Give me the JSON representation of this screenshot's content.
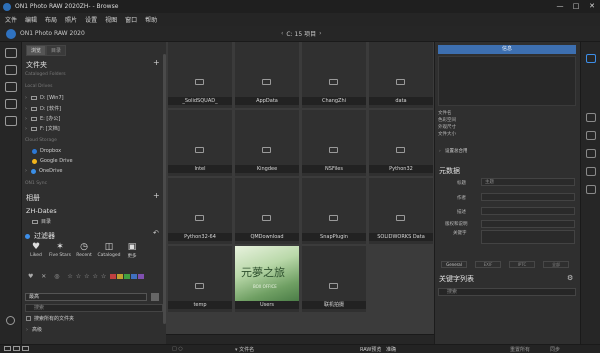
{
  "window": {
    "title": "ON1 Photo RAW 2020ZH- - Browse",
    "controls": [
      "—",
      "□",
      "✕"
    ]
  },
  "menu": [
    "文件",
    "编辑",
    "布局",
    "照片",
    "设置",
    "视图",
    "窗口",
    "帮助"
  ],
  "header": {
    "app_name": "ON1 Photo RAW 2020",
    "path": "C: 15 项目",
    "back": "‹",
    "forward": "›"
  },
  "left_panel": {
    "tabs": [
      "浏览",
      "目录"
    ],
    "folders_title": "文件夹",
    "cataloged_label": "Cataloged Folders",
    "local_label": "Local Drives",
    "drives": [
      "D: [Win7]",
      "D: [软件]",
      "E: [办公]",
      "F: [文档]"
    ],
    "cloud_label": "Cloud Storage",
    "cloud": [
      "Dropbox",
      "Google Drive",
      "OneDrive"
    ],
    "sync_label": "ON1 Sync",
    "albums_title": "相册",
    "albums_sub": "ZH-Dates",
    "album_item": "目录",
    "filters_title": "过滤器",
    "filters": [
      {
        "icon": "heart",
        "label": "Liked"
      },
      {
        "icon": "stars",
        "label": "Five Stars"
      },
      {
        "icon": "clock",
        "label": "Recent"
      },
      {
        "icon": "catalog",
        "label": "Cataloged"
      },
      {
        "icon": "more",
        "label": "更多"
      }
    ],
    "sort_value": "最高",
    "search_placeholder": "搜索",
    "search_option": "搜索所有的文件夹",
    "advanced": "高级"
  },
  "grid": {
    "items": [
      "_SolidSQUAD_",
      "AppData",
      "ChangZhi",
      "data",
      "Intel",
      "Kingdee",
      "NSFiles",
      "Python32",
      "Python32-64",
      "QMDownload",
      "SnapPlugin",
      "SOLIDWORKS Data",
      "temp",
      "Users",
      "联机拍摄"
    ],
    "thumb_text": "元夢之旅",
    "thumb_sub": "BOX OFFICE"
  },
  "right_panel": {
    "top_button": "信息",
    "info_labels": [
      "文件名",
      "色彩空间",
      "外观尺寸",
      "文件大小"
    ],
    "preset_label": "设置总合用",
    "metadata_title": "元数据",
    "meta_fields": [
      {
        "label": "标题",
        "value": "主题"
      },
      {
        "label": "作者",
        "value": ""
      },
      {
        "label": "描述",
        "value": ""
      },
      {
        "label": "版权和说明",
        "value": ""
      },
      {
        "label": "关键字",
        "value": ""
      }
    ],
    "tabs": [
      "General",
      "EXIF",
      "IPTC",
      "全部"
    ],
    "keywords_title": "关键字列表",
    "keywords_search": "搜索"
  },
  "statusbar": {
    "sort_label": "文件名",
    "raw_label": "RAW预览",
    "raw_value": "准确",
    "reset": "重置所有",
    "sync": "同步"
  },
  "colors": {
    "accent": "#3d6fb0",
    "highlight": "#3d8ee8"
  }
}
